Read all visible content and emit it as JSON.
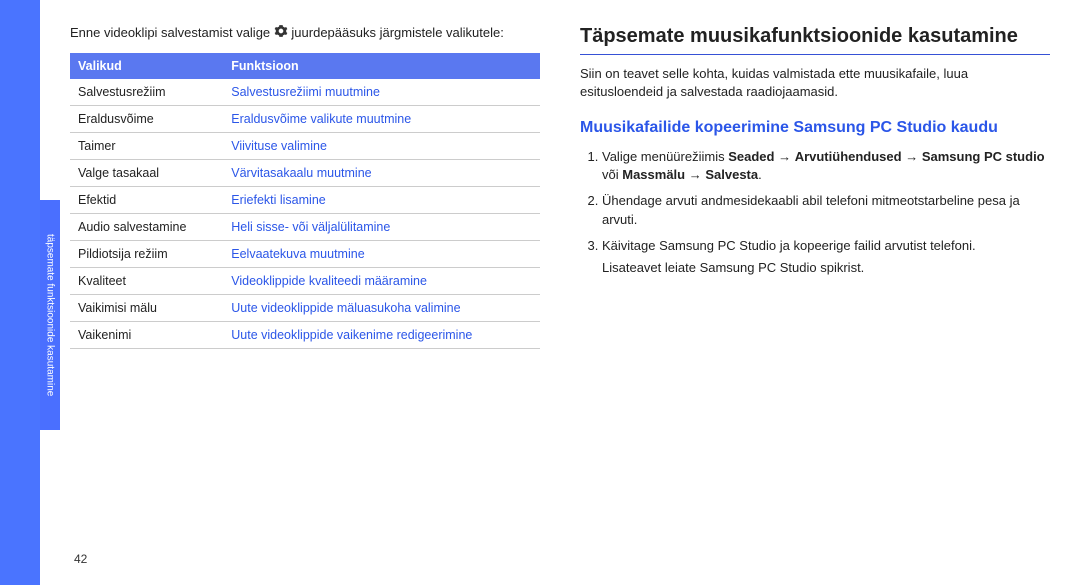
{
  "sideTab": "täpsemate funktsioonide kasutamine",
  "leftColumn": {
    "introPre": "Enne videoklipi salvestamist valige ",
    "introPost": " juurdepääsuks järgmistele valikutele:",
    "table": {
      "headers": {
        "col1": "Valikud",
        "col2": "Funktsioon"
      },
      "rows": [
        {
          "opt": "Salvestusrežiim",
          "func": "Salvestusrežiimi muutmine"
        },
        {
          "opt": "Eraldusvõime",
          "func": "Eraldusvõime valikute muutmine"
        },
        {
          "opt": "Taimer",
          "func": "Viivituse valimine"
        },
        {
          "opt": "Valge tasakaal",
          "func": "Värvitasakaalu muutmine"
        },
        {
          "opt": "Efektid",
          "func": "Eriefekti lisamine"
        },
        {
          "opt": "Audio salvestamine",
          "func": "Heli sisse- või väljalülitamine"
        },
        {
          "opt": "Pildiotsija režiim",
          "func": "Eelvaatekuva muutmine"
        },
        {
          "opt": "Kvaliteet",
          "func": "Videoklippide kvaliteedi määramine"
        },
        {
          "opt": "Vaikimisi mälu",
          "func": "Uute videoklippide mäluasukoha valimine"
        },
        {
          "opt": "Vaikenimi",
          "func": "Uute videoklippide vaikenime redigeerimine"
        }
      ]
    },
    "pageNumber": "42"
  },
  "rightColumn": {
    "title": "Täpsemate muusikafunktsioonide kasutamine",
    "desc": "Siin on teavet selle kohta, kuidas valmistada ette muusikafaile, luua esitusloendeid ja salvestada raadiojaamasid.",
    "subTitle": "Muusikafailide kopeerimine Samsung PC Studio kaudu",
    "steps": [
      {
        "pre": "Valige menüürežiimis ",
        "b1": "Seaded",
        "a1": " → ",
        "b2": "Arvutiühendused",
        "a2": " → ",
        "b3": "Samsung PC studio",
        "a3": " või ",
        "b4": "Massmälu",
        "a4": " → ",
        "b5": "Salvesta",
        "post": "."
      },
      {
        "text": "Ühendage arvuti andmesidekaabli abil telefoni mitmeotstarbeline pesa ja arvuti."
      },
      {
        "text": "Käivitage Samsung PC Studio ja kopeerige failid arvutist telefoni.",
        "sub": "Lisateavet leiate Samsung PC Studio spikrist."
      }
    ]
  }
}
